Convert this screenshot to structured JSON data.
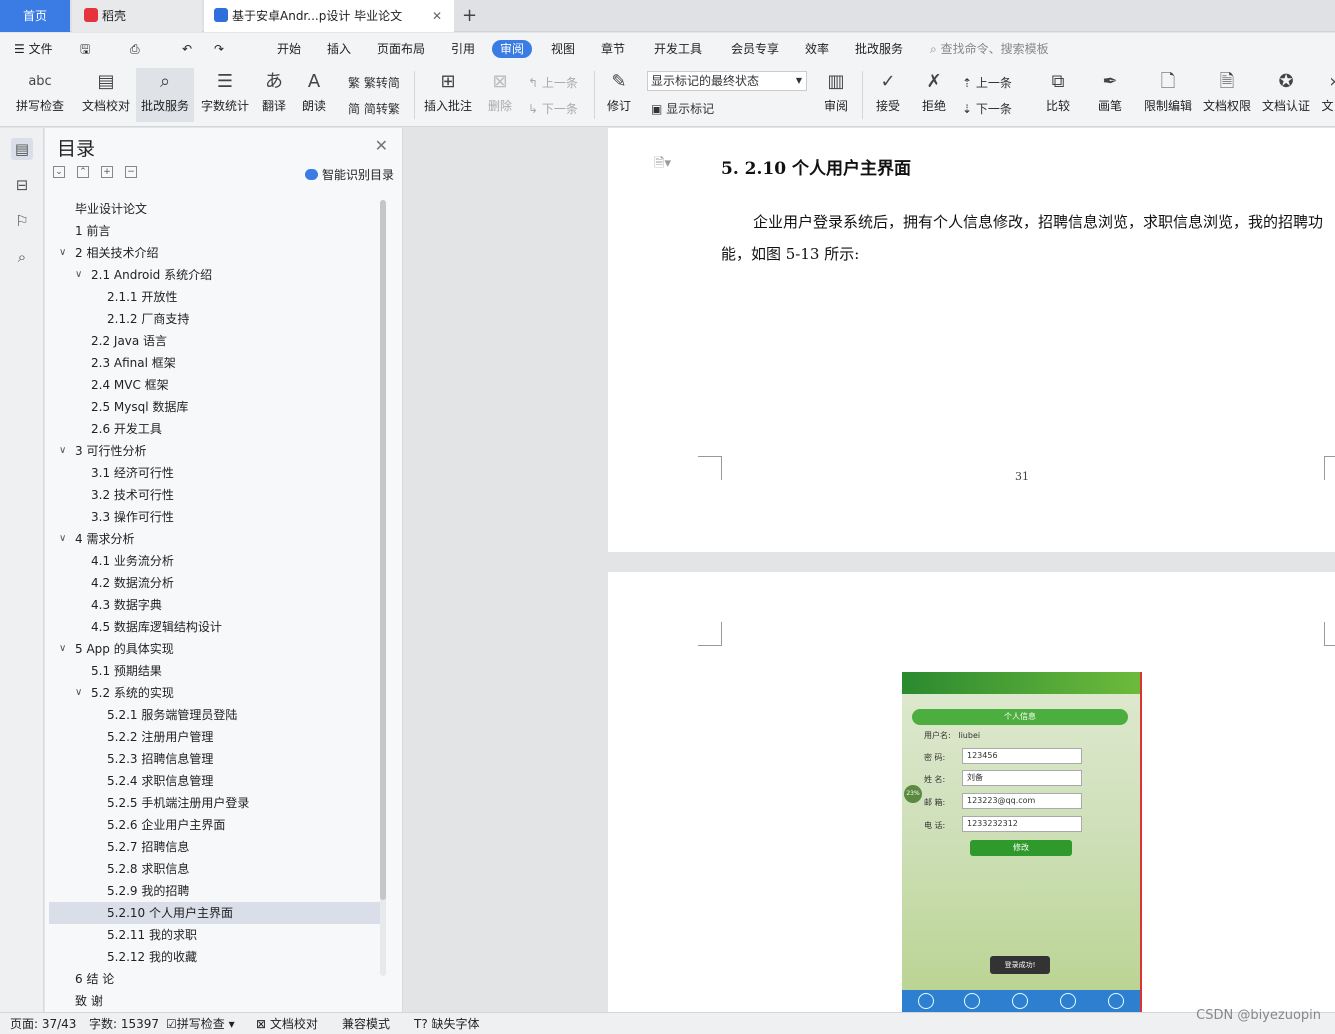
{
  "tabs": {
    "home": "首页",
    "daoke": "稻壳",
    "doc": "基于安卓Andr...p设计 毕业论文"
  },
  "menubar": {
    "file": "文件",
    "items": [
      "开始",
      "插入",
      "页面布局",
      "引用",
      "审阅",
      "视图",
      "章节",
      "开发工具",
      "会员专享",
      "效率",
      "批改服务"
    ],
    "search": "查找命令、搜索模板"
  },
  "ribbon": {
    "spell": "拼写检查",
    "proof": "文档校对",
    "review_service": "批改服务",
    "wordcount": "字数统计",
    "translate": "翻译",
    "read": "朗读",
    "trad": "繁转简",
    "simp": "简转繁",
    "insert_comment": "插入批注",
    "delete": "删除",
    "prev": "上一条",
    "next": "下一条",
    "track": "修订",
    "markup_state": "显示标记的最终状态",
    "show_markup": "显示标记",
    "review": "审阅",
    "accept": "接受",
    "reject": "拒绝",
    "prev2": "上一条",
    "next2": "下一条",
    "compare": "比较",
    "pen": "画笔",
    "restrict": "限制编辑",
    "permission": "文档权限",
    "certify": "文档认证",
    "more": "文"
  },
  "toc": {
    "title": "目录",
    "smart": "智能识别目录",
    "items": [
      {
        "t": "毕业设计论文"
      },
      {
        "t": "1  前言"
      },
      {
        "t": "2  相关技术介绍"
      },
      {
        "t": "2.1 Android 系统介绍"
      },
      {
        "t": "2.1.1  开放性"
      },
      {
        "t": "2.1.2  厂商支持"
      },
      {
        "t": "2.2 Java 语言"
      },
      {
        "t": "2.3 Afinal 框架"
      },
      {
        "t": "2.4 MVC 框架"
      },
      {
        "t": "2.5 Mysql 数据库"
      },
      {
        "t": "2.6  开发工具"
      },
      {
        "t": "3  可行性分析"
      },
      {
        "t": "3.1  经济可行性"
      },
      {
        "t": "3.2  技术可行性"
      },
      {
        "t": "3.3  操作可行性"
      },
      {
        "t": "4  需求分析"
      },
      {
        "t": "4.1  业务流分析"
      },
      {
        "t": "4.2    数据流分析"
      },
      {
        "t": "4.3    数据字典"
      },
      {
        "t": "4.5  数据库逻辑结构设计"
      },
      {
        "t": "5 App 的具体实现"
      },
      {
        "t": "5.1  预期结果"
      },
      {
        "t": "5.2  系统的实现"
      },
      {
        "t": "5.2.1  服务端管理员登陆"
      },
      {
        "t": "5.2.2  注册用户管理"
      },
      {
        "t": "5.2.3  招聘信息管理"
      },
      {
        "t": "5.2.4  求职信息管理"
      },
      {
        "t": "5.2.5  手机端注册用户登录"
      },
      {
        "t": "5.2.6  企业用户主界面"
      },
      {
        "t": "5.2.7  招聘信息"
      },
      {
        "t": "5.2.8  求职信息"
      },
      {
        "t": "5.2.9  我的招聘"
      },
      {
        "t": "5.2.10  个人用户主界面"
      },
      {
        "t": "5.2.11  我的求职"
      },
      {
        "t": "5.2.12  我的收藏"
      },
      {
        "t": "6    结  论"
      },
      {
        "t": "致    谢"
      }
    ]
  },
  "document": {
    "heading": "5. 2.10  个人用户主界面",
    "body": "企业用户登录系统后，拥有个人信息修改，招聘信息浏览，求职信息浏览，我的招聘功能，如图 5-13 所示:",
    "page_number": "31"
  },
  "phone": {
    "bar": "个人信息",
    "username_label": "用户名:",
    "username": "liubei",
    "password_label": "密  码:",
    "password": "123456",
    "name_label": "姓  名:",
    "name": "刘备",
    "email_label": "邮  箱:",
    "email": "123223@qq.com",
    "phone_label": "电  话:",
    "phone": "1233232312",
    "modify": "修改",
    "toast": "登录成功!",
    "badge": "23%"
  },
  "status": {
    "page": "页面: 37/43",
    "words": "字数: 15397",
    "spell": "拼写检查",
    "proof": "文档校对",
    "compat": "兼容模式",
    "missing_font": "缺失字体"
  },
  "watermark": "CSDN @biyezuopin"
}
